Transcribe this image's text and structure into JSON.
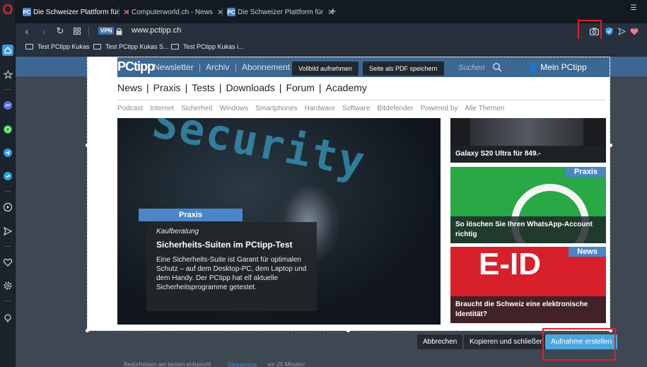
{
  "tabs": [
    {
      "label": "Die Schweizer Plattform für",
      "favicon": "PC",
      "active": true
    },
    {
      "label": "Computerworld.ch - News",
      "favicon": "cw",
      "active": false
    },
    {
      "label": "Die Schweizer Plattform für",
      "favicon": "PC",
      "active": false
    }
  ],
  "address": {
    "vpn": "VPN",
    "url": "www.pctipp.ch"
  },
  "bookmarks": [
    "Test PCtipp Kukas",
    "Test PCtipp Kukas S...",
    "Test PCtipp Kukas i..."
  ],
  "site": {
    "logo": "PCtipp",
    "top_links": [
      "Newsletter",
      "Archiv",
      "Abonnement"
    ],
    "search_placeholder": "Suchen",
    "account": "Mein PCtipp",
    "main_nav": [
      "News",
      "Praxis",
      "Tests",
      "Downloads",
      "Forum",
      "Academy"
    ],
    "sub_nav": [
      "Podcast",
      "Internet",
      "Sicherheit",
      "Windows",
      "Smartphones",
      "Hardware",
      "Software",
      "Bitdefender",
      "Powered by",
      "Alle Themen"
    ],
    "hero": {
      "image_text": "Security",
      "category": "Praxis",
      "kicker": "Kaufberatung",
      "headline": "Sicherheits-Suiten im PCtipp-Test",
      "lead": "Eine Sicherheits-Suite ist Garant für optimalen Schutz – auf dem Desktop-PC, dem Laptop und dem Handy. Der PCtipp hat elf aktuelle Sicherheitsprogramme getestet."
    },
    "teasers": [
      {
        "title": "Galaxy S20 Ultra für 849.-",
        "badge": ""
      },
      {
        "title": "So löschen Sie Ihren WhatsApp-Account richtig",
        "badge": "Praxis"
      },
      {
        "title": "Braucht die Schweiz eine elektronische Identität?",
        "badge": "News",
        "image_text": "E-ID"
      }
    ]
  },
  "snapshot": {
    "full_button": "Vollbild aufnehmen",
    "pdf_button": "Seite als PDF speichern",
    "cancel": "Abbrechen",
    "copy_close": "Kopieren und schließen",
    "capture": "Aufnahme erstellen"
  },
  "footer": {
    "left": "Bedürfnissen am besten entspricht",
    "mid": "Streaming",
    "right": "vor 25 Minuten"
  },
  "colors": {
    "accent": "#4aa7de",
    "highlight": "#e0202a",
    "site_blue": "#3d6793"
  }
}
